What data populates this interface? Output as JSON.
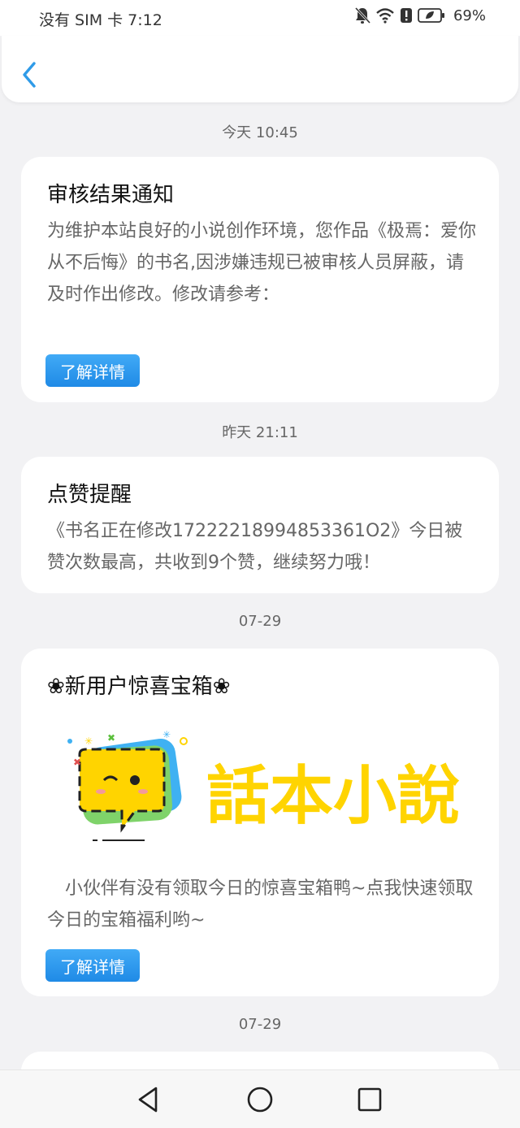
{
  "status_bar": {
    "carrier_time": "没有 SIM 卡 7:12",
    "battery_percent": "69%",
    "icons": [
      "bell-muted-icon",
      "wifi-icon",
      "alert-icon",
      "battery-icon"
    ]
  },
  "nav": {
    "back_icon": "chevron-left-icon"
  },
  "messages": [
    {
      "time": "今天 10:45",
      "title": "审核结果通知",
      "body": "为维护本站良好的小说创作环境，您作品《极焉：爱你从不后悔》的书名,因涉嫌违规已被审核人员屏蔽，请及时作出修改。修改请参考：",
      "button": "了解详情"
    },
    {
      "time": "昨天 21:11",
      "title": "点赞提醒",
      "body": "《书名正在修改17222218994853361O2》今日被赞次数最高，共收到9个赞，继续努力哦！"
    },
    {
      "time": "07-29",
      "title": "❀新用户惊喜宝箱❀",
      "logo_text": "話本小說",
      "body": "　小伙伴有没有领取今日的惊喜宝箱鸭~点我快速领取今日的宝箱福利哟~",
      "button": "了解详情"
    },
    {
      "time": "07-29"
    }
  ],
  "colors": {
    "accent": "#1f8ae6",
    "logo_yellow": "#ffd400",
    "background": "#f2f2f4"
  }
}
